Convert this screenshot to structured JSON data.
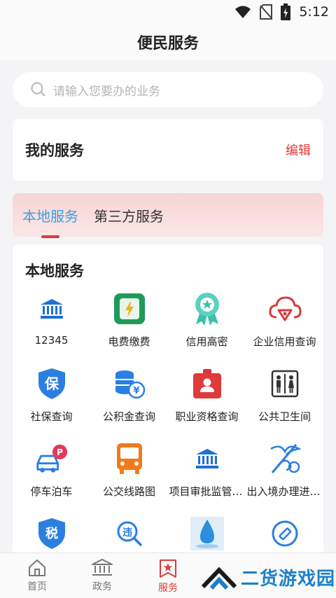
{
  "status_bar": {
    "time": "5:12"
  },
  "header": {
    "title": "便民服务"
  },
  "search": {
    "placeholder": "请输入您要办的业务"
  },
  "my_services": {
    "label": "我的服务",
    "edit": "编辑"
  },
  "tabs": [
    {
      "label": "本地服务"
    },
    {
      "label": "第三方服务"
    }
  ],
  "local": {
    "title": "本地服务",
    "items": [
      {
        "label": "12345",
        "icon": "bank-icon"
      },
      {
        "label": "电费缴费",
        "icon": "lightning-card-icon"
      },
      {
        "label": "信用高密",
        "icon": "star-badge-icon"
      },
      {
        "label": "企业信用查询",
        "icon": "cloud-check-icon"
      },
      {
        "label": "社保查询",
        "icon": "shield-bao-icon"
      },
      {
        "label": "公积金查询",
        "icon": "coins-yen-icon"
      },
      {
        "label": "职业资格查询",
        "icon": "id-badge-icon"
      },
      {
        "label": "公共卫生间",
        "icon": "restroom-icon"
      },
      {
        "label": "停车泊车",
        "icon": "car-parking-icon"
      },
      {
        "label": "公交线路图",
        "icon": "bus-icon"
      },
      {
        "label": "项目审批监管平台",
        "icon": "bank-icon"
      },
      {
        "label": "出入境办理进度查询",
        "icon": "caduceus-icon"
      },
      {
        "label": "",
        "icon": "tax-shield-icon"
      },
      {
        "label": "",
        "icon": "violation-search-icon"
      },
      {
        "label": "",
        "icon": "water-drop-icon"
      },
      {
        "label": "",
        "icon": "vaccine-icon"
      }
    ]
  },
  "bottom_nav": [
    {
      "label": "首页",
      "icon": "home-icon"
    },
    {
      "label": "政务",
      "icon": "government-icon"
    },
    {
      "label": "服务",
      "icon": "service-star-icon",
      "active": true
    }
  ],
  "watermark": {
    "text": "二货游戏园"
  },
  "colors": {
    "accent_red": "#e03a3a",
    "tab_blue": "#3aa0e5",
    "icon_blue": "#1f6fd6"
  }
}
